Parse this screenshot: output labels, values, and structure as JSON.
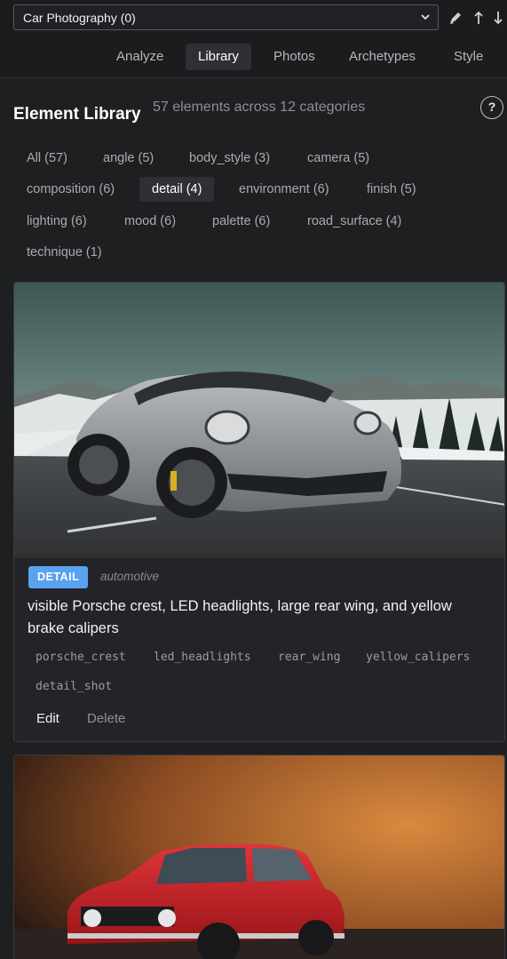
{
  "topbar": {
    "collection": "Car Photography (0)",
    "icons": [
      "edit-icon",
      "upload-icon",
      "download-icon"
    ]
  },
  "tabs": [
    {
      "label": "Analyze",
      "active": false
    },
    {
      "label": "Library",
      "active": true
    },
    {
      "label": "Photos",
      "active": false
    },
    {
      "label": "Archetypes",
      "active": false
    },
    {
      "label": "Style",
      "active": false
    }
  ],
  "header": {
    "title": "Element Library",
    "subtitle": "57 elements across 12 categories",
    "help": "?"
  },
  "filters": [
    {
      "label": "All (57)",
      "active": false
    },
    {
      "label": "angle (5)",
      "active": false
    },
    {
      "label": "body_style (3)",
      "active": false
    },
    {
      "label": "camera (5)",
      "active": false
    },
    {
      "label": "composition (6)",
      "active": false
    },
    {
      "label": "detail (4)",
      "active": true
    },
    {
      "label": "environment (6)",
      "active": false
    },
    {
      "label": "finish (5)",
      "active": false
    },
    {
      "label": "lighting (6)",
      "active": false
    },
    {
      "label": "mood (6)",
      "active": false
    },
    {
      "label": "palette (6)",
      "active": false
    },
    {
      "label": "road_surface (4)",
      "active": false
    },
    {
      "label": "technique (1)",
      "active": false
    }
  ],
  "cards": [
    {
      "badge": "DETAIL",
      "category": "automotive",
      "description": "visible Porsche crest, LED headlights, large rear wing, and yellow brake calipers",
      "tags": [
        "porsche_crest",
        "led_headlights",
        "rear_wing",
        "yellow_calipers",
        "detail_shot"
      ],
      "edit_label": "Edit",
      "delete_label": "Delete"
    }
  ],
  "colors": {
    "background": "#1e1f21",
    "accent_badge": "#5aa1f0",
    "active_tab": "#2e3034"
  }
}
